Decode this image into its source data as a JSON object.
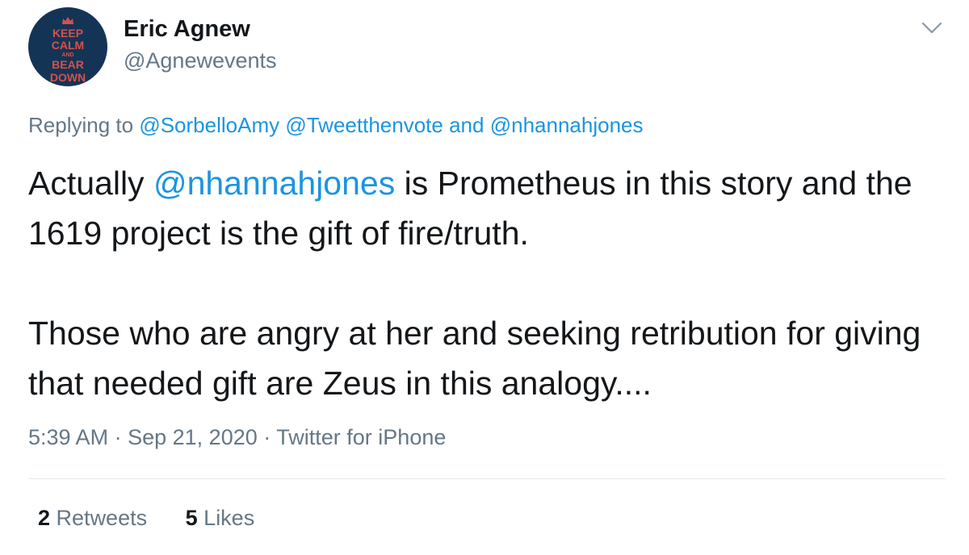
{
  "author": {
    "display_name": "Eric Agnew",
    "handle": "@Agnewevents",
    "avatar": {
      "icon": "keep-calm-crown-avatar",
      "lines": [
        "KEEP",
        "CALM",
        "AND",
        "BEAR",
        "DOWN"
      ],
      "bg_color": "#143456",
      "text_color": "#d8504a"
    }
  },
  "menu_icon": "chevron-down-icon",
  "reply_context": {
    "prefix": "Replying to",
    "mentions": [
      "@SorbelloAmy",
      "@Tweetthenvote"
    ],
    "conjunction": "and",
    "last_mention": "@nhannahjones"
  },
  "tweet": {
    "p1_before": "Actually ",
    "p1_mention": "@nhannahjones",
    "p1_after": " is Prometheus in this story and the 1619 project is the gift of fire/truth.",
    "p2": "Those who are angry at her and seeking retribution for giving that needed gift are Zeus in this analogy...."
  },
  "meta": {
    "time": "5:39 AM",
    "date": "Sep 21, 2020",
    "source": "Twitter for iPhone",
    "separator": "·"
  },
  "stats": {
    "retweets_count": "2",
    "retweets_label": "Retweets",
    "likes_count": "5",
    "likes_label": "Likes"
  },
  "colors": {
    "link": "#1b95e0",
    "secondary_text": "#657786",
    "primary_text": "#14171a",
    "divider": "#e1e8ed"
  }
}
